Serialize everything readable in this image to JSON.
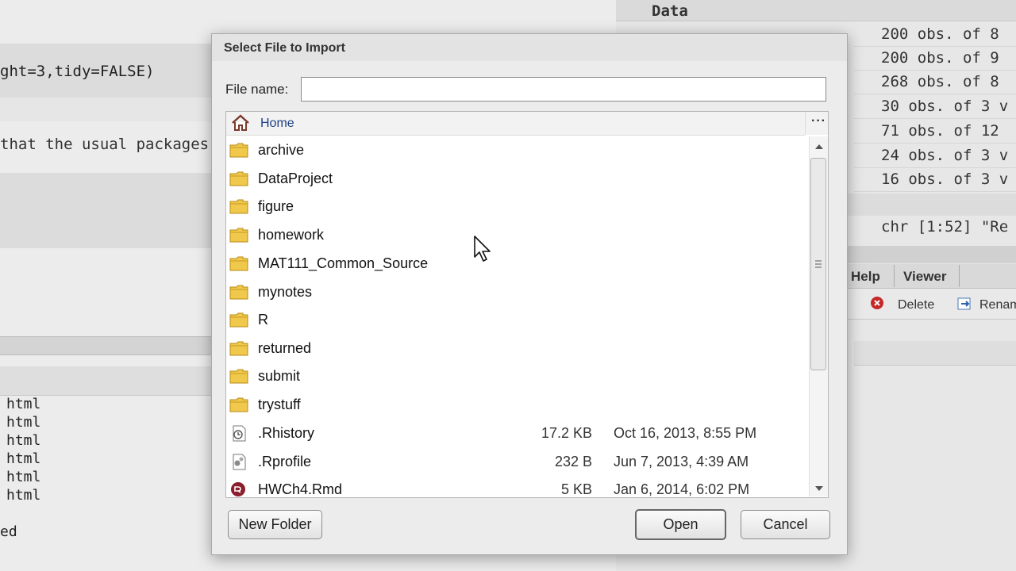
{
  "background": {
    "code_fragment": "ght=3,tidy=FALSE)",
    "prose_fragment": "that the usual packages",
    "console_lines": [
      "html",
      "html",
      "html",
      "html",
      "html",
      "html"
    ],
    "console_bottom": "ed",
    "environment": {
      "title": "Data",
      "values": [
        "200 obs. of 8",
        "200 obs. of 9",
        "268 obs. of 8",
        "30 obs. of 3 v",
        "71 obs. of 12",
        "24 obs. of 3 v",
        "16 obs. of 3 v"
      ],
      "value_row": "chr [1:52] \"Re"
    },
    "pane_tabs": [
      "Help",
      "Viewer"
    ],
    "pane_tools": [
      "Delete",
      "Renam"
    ]
  },
  "dialog": {
    "title": "Select File to Import",
    "file_name_label": "File name:",
    "file_name_value": "",
    "breadcrumb": "Home",
    "more_label": "···",
    "items": [
      {
        "name": "archive",
        "type": "folder",
        "size": "",
        "date": ""
      },
      {
        "name": "DataProject",
        "type": "folder",
        "size": "",
        "date": ""
      },
      {
        "name": "figure",
        "type": "folder",
        "size": "",
        "date": ""
      },
      {
        "name": "homework",
        "type": "folder",
        "size": "",
        "date": ""
      },
      {
        "name": "MAT111_Common_Source",
        "type": "folder",
        "size": "",
        "date": ""
      },
      {
        "name": "mynotes",
        "type": "folder",
        "size": "",
        "date": ""
      },
      {
        "name": "R",
        "type": "folder",
        "size": "",
        "date": ""
      },
      {
        "name": "returned",
        "type": "folder",
        "size": "",
        "date": ""
      },
      {
        "name": "submit",
        "type": "folder",
        "size": "",
        "date": ""
      },
      {
        "name": "trystuff",
        "type": "folder",
        "size": "",
        "date": ""
      },
      {
        "name": ".Rhistory",
        "type": "history-file",
        "size": "17.2 KB",
        "date": "Oct 16, 2013, 8:55 PM"
      },
      {
        "name": ".Rprofile",
        "type": "profile-file",
        "size": "232 B",
        "date": "Jun 7, 2013, 4:39 AM"
      },
      {
        "name": "HWCh4.Rmd",
        "type": "rmd-file",
        "size": "5 KB",
        "date": "Jan 6, 2014, 6:02 PM"
      }
    ],
    "buttons": {
      "new_folder": "New Folder",
      "open": "Open",
      "cancel": "Cancel"
    }
  },
  "colors": {
    "folder": "#e8b931",
    "breadcrumb": "#1d3f86",
    "rmd_icon": "#8b1e2c"
  }
}
